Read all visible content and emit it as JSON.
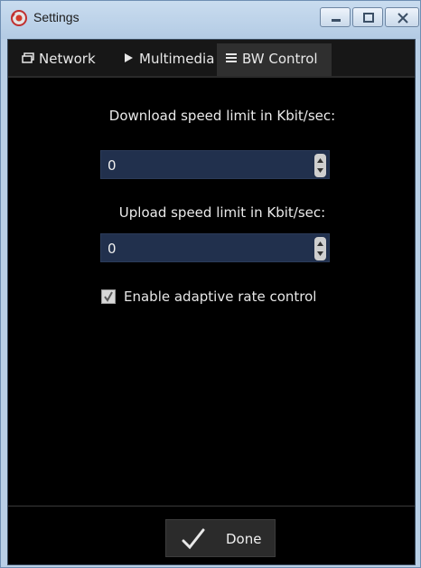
{
  "window": {
    "title": "Settings",
    "app_icon": "settings-app-icon",
    "controls": [
      "minimize-icon",
      "maximize-icon",
      "close-icon"
    ]
  },
  "tabs": [
    {
      "label": "Network",
      "icon": "window-icon",
      "active": false
    },
    {
      "label": "Multimedia",
      "icon": "play-icon",
      "active": false
    },
    {
      "label": "BW Control",
      "icon": "menu-lines-icon",
      "active": true
    }
  ],
  "bw_control": {
    "download": {
      "label": "Download speed limit in Kbit/sec:",
      "value": "0"
    },
    "upload": {
      "label": "Upload speed limit in Kbit/sec:",
      "value": "0"
    },
    "adaptive": {
      "label": "Enable adaptive rate control",
      "checked": true
    }
  },
  "footer": {
    "done_label": "Done",
    "done_icon": "checkmark-icon"
  },
  "colors": {
    "background": "#000000",
    "input_bg": "#21304d",
    "active_tab": "#2f2f2f",
    "titlebar": "#c0d5ea"
  }
}
